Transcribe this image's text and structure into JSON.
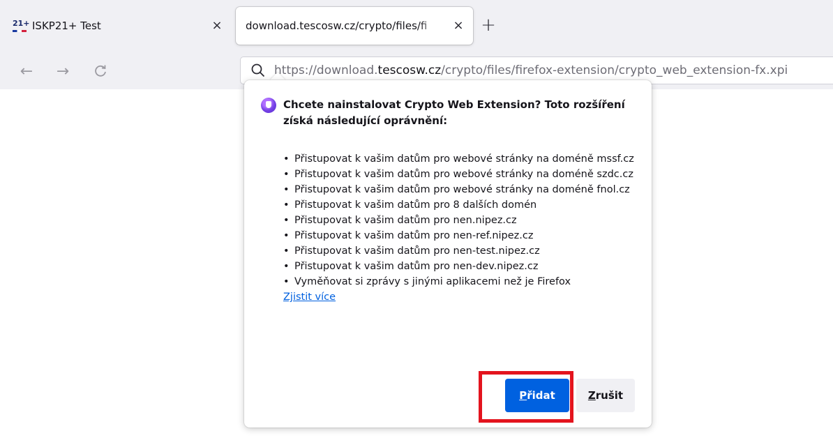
{
  "tabs": [
    {
      "favicon_text": "21+",
      "title": "ISKP21+ Test",
      "close_label": "×"
    },
    {
      "title": "download.tescosw.cz/crypto/files/fi",
      "close_label": "×"
    }
  ],
  "new_tab_label": "+",
  "nav": {
    "back_icon": "←",
    "forward_icon": "→",
    "reload_icon": "C"
  },
  "url": {
    "prefix": "https://download.",
    "domain": "tescosw.cz",
    "suffix": "/crypto/files/firefox-extension/crypto_web_extension-fx.xpi"
  },
  "dialog": {
    "message": "Chcete nainstalovat Crypto Web Extension? Toto rozšíření získá následující oprávnění:",
    "permissions": [
      "Přistupovat k vašim datům pro webové stránky na doméně mssf.cz",
      "Přistupovat k vašim datům pro webové stránky na doméně szdc.cz",
      "Přistupovat k vašim datům pro webové stránky na doméně fnol.cz",
      "Přistupovat k vašim datům pro 8 dalších domén",
      "Přistupovat k vašim datům pro nen.nipez.cz",
      "Přistupovat k vašim datům pro nen-ref.nipez.cz",
      "Přistupovat k vašim datům pro nen-test.nipez.cz",
      "Přistupovat k vašim datům pro nen-dev.nipez.cz",
      "Vyměňovat si zprávy s jinými aplikacemi než je Firefox"
    ],
    "learn_more": "Zjistit více",
    "add_button": {
      "accesskey": "P",
      "rest": "řidat"
    },
    "cancel_button": {
      "accesskey": "Z",
      "rest": "rušit"
    }
  },
  "colors": {
    "primary_button": "#0061e0",
    "link": "#0060df",
    "highlight": "#e3141e"
  }
}
